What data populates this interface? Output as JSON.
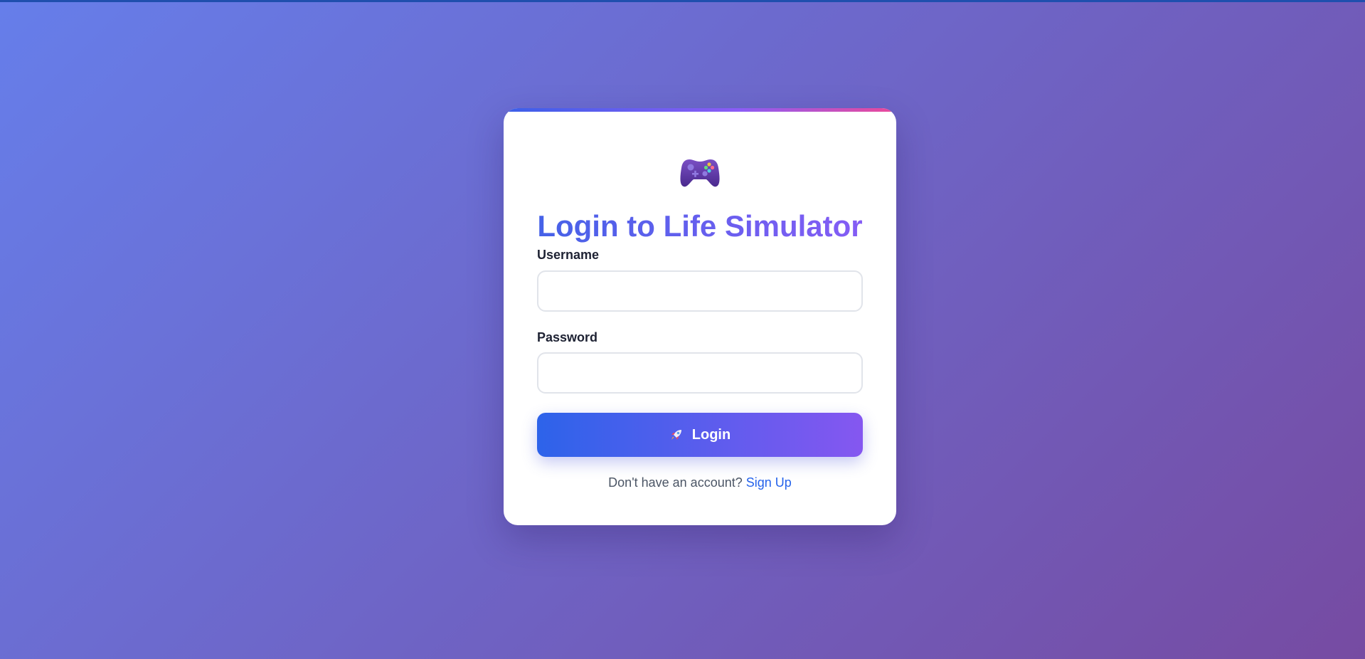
{
  "colors": {
    "background_start": "#667eea",
    "background_end": "#764ba2",
    "accent_blue": "#2d63ea",
    "accent_purple": "#8557f0",
    "link": "#2563eb"
  },
  "logo": {
    "icon": "game-controller-icon"
  },
  "title": "Login to Life Simulator",
  "form": {
    "username_label": "Username",
    "username_value": "",
    "password_label": "Password",
    "password_value": "",
    "submit_icon": "rocket-icon",
    "submit_label": "Login"
  },
  "footer": {
    "prompt": "Don't have an account?",
    "link_label": "Sign Up"
  }
}
